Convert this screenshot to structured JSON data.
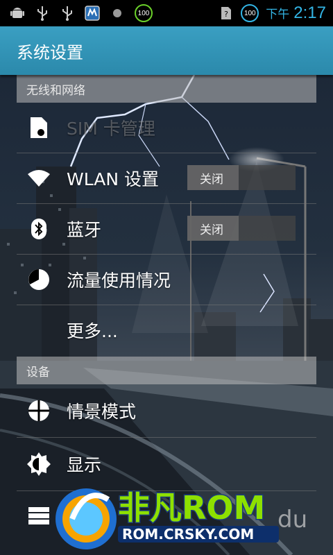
{
  "status_bar": {
    "ampm": "下午",
    "time": "2:17",
    "badge_left": "100",
    "badge_right": "100",
    "icons": [
      "android-debug-icon",
      "usb-icon",
      "usb-icon",
      "app-notification-icon",
      "moon-icon",
      "battery-saver-icon",
      "sim-unknown-icon",
      "battery-icon"
    ]
  },
  "action_bar": {
    "title": "系统设置"
  },
  "sections": {
    "wireless": {
      "header": "无线和网络",
      "sim": "SIM 卡管理",
      "wlan": "WLAN 设置",
      "wlan_switch": "关闭",
      "bluetooth": "蓝牙",
      "bluetooth_switch": "关闭",
      "data_usage": "流量使用情况",
      "more": "更多..."
    },
    "device": {
      "header": "设备",
      "profiles": "情景模式",
      "display": "显示"
    }
  },
  "watermark": {
    "brand": "非凡ROM",
    "url": "ROM.CRSKY.COM",
    "du": "du"
  },
  "colors": {
    "accent": "#33b5e5",
    "action_bar": "#2b89ab",
    "rom_green": "#8ee000"
  }
}
